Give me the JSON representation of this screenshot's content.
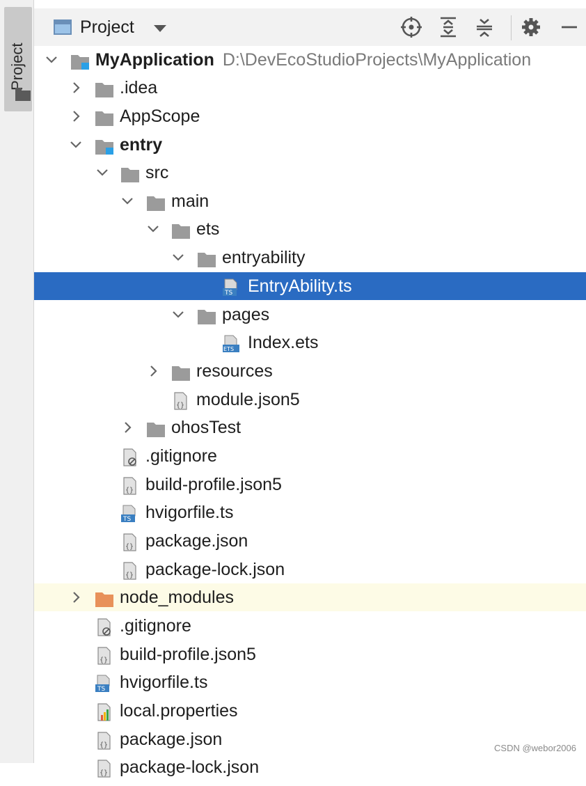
{
  "side_panel": {
    "tab_label": "Project"
  },
  "toolbar": {
    "title": "Project",
    "icons": [
      "locate-icon",
      "expand-all-icon",
      "collapse-all-icon",
      "settings-icon",
      "hide-icon"
    ]
  },
  "colors": {
    "selection": "#2a6bc2",
    "highlight": "#fdfbe6",
    "folder": "#9b9b9b",
    "excluded_folder": "#e8915a",
    "ts_badge": "#3a7fc1"
  },
  "tree": {
    "rows": [
      {
        "label": "MyApplication",
        "path": "D:\\DevEcoStudioProjects\\MyApplication",
        "icon": "module-folder-icon",
        "state": "expanded"
      },
      {
        "label": ".idea",
        "icon": "folder-icon",
        "state": "collapsed"
      },
      {
        "label": "AppScope",
        "icon": "folder-icon",
        "state": "collapsed"
      },
      {
        "label": "entry",
        "icon": "module-folder-icon",
        "state": "expanded"
      },
      {
        "label": "src",
        "icon": "folder-icon",
        "state": "expanded"
      },
      {
        "label": "main",
        "icon": "folder-icon",
        "state": "expanded"
      },
      {
        "label": "ets",
        "icon": "folder-icon",
        "state": "expanded"
      },
      {
        "label": "entryability",
        "icon": "folder-icon",
        "state": "expanded"
      },
      {
        "label": "EntryAbility.ts",
        "icon": "ts-file-icon",
        "state": "selected"
      },
      {
        "label": "pages",
        "icon": "folder-icon",
        "state": "expanded"
      },
      {
        "label": "Index.ets",
        "icon": "ets-file-icon"
      },
      {
        "label": "resources",
        "icon": "folder-icon",
        "state": "collapsed"
      },
      {
        "label": "module.json5",
        "icon": "json-file-icon"
      },
      {
        "label": "ohosTest",
        "icon": "folder-icon",
        "state": "collapsed"
      },
      {
        "label": ".gitignore",
        "icon": "gitignore-file-icon"
      },
      {
        "label": "build-profile.json5",
        "icon": "json-file-icon"
      },
      {
        "label": "hvigorfile.ts",
        "icon": "ts-file-icon"
      },
      {
        "label": "package.json",
        "icon": "json-file-icon"
      },
      {
        "label": "package-lock.json",
        "icon": "json-file-icon"
      },
      {
        "label": "node_modules",
        "icon": "excluded-folder-icon",
        "state": "collapsed"
      },
      {
        "label": ".gitignore",
        "icon": "gitignore-file-icon"
      },
      {
        "label": "build-profile.json5",
        "icon": "json-file-icon"
      },
      {
        "label": "hvigorfile.ts",
        "icon": "ts-file-icon"
      },
      {
        "label": "local.properties",
        "icon": "properties-file-icon"
      },
      {
        "label": "package.json",
        "icon": "json-file-icon"
      },
      {
        "label": "package-lock.json",
        "icon": "json-file-icon"
      }
    ]
  },
  "watermark": "CSDN @webor2006"
}
